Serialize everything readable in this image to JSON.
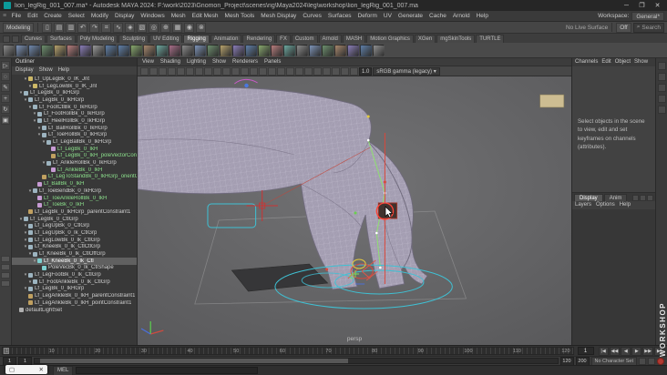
{
  "titlebar": {
    "title": "lion_legRig_001_007.ma* - Autodesk MAYA 2024: F:\\work\\2023\\Gnomon_Project\\scenes\\rig\\Maya2024\\leg\\workshop\\lion_legRig_001_007.ma",
    "minimize": "─",
    "maximize": "❐",
    "close": "✕"
  },
  "menubar": {
    "menus": [
      "File",
      "Edit",
      "Create",
      "Select",
      "Modify",
      "Display",
      "Windows",
      "Mesh",
      "Edit Mesh",
      "Mesh Tools",
      "Mesh Display",
      "Curves",
      "Surfaces",
      "Deform",
      "UV",
      "Generate",
      "Cache",
      "Arnold",
      "Help"
    ],
    "workspace_label": "Workspace:",
    "workspace_value": "General*"
  },
  "statusline": {
    "menu_set": "Modeling",
    "live_surface": "No Live Surface",
    "symmetry": "Off",
    "search": "Search",
    "icons": [
      {
        "name": "new-scene-icon",
        "glyph": "▯"
      },
      {
        "name": "open-scene-icon",
        "glyph": "▤"
      },
      {
        "name": "save-scene-icon",
        "glyph": "▥"
      },
      {
        "name": "undo-icon",
        "glyph": "↶"
      },
      {
        "name": "redo-icon",
        "glyph": "↷"
      },
      {
        "name": "snap-to-grid-icon",
        "glyph": "⌗"
      },
      {
        "name": "snap-to-curve-icon",
        "glyph": "∿"
      },
      {
        "name": "snap-to-point-icon",
        "glyph": "◈"
      },
      {
        "name": "snap-to-plane-icon",
        "glyph": "▧"
      },
      {
        "name": "make-live-icon",
        "glyph": "◎"
      },
      {
        "name": "construction-history-icon",
        "glyph": "⊕"
      },
      {
        "name": "render-view-icon",
        "glyph": "▦"
      },
      {
        "name": "render-current-frame-icon",
        "glyph": "◉"
      },
      {
        "name": "ipr-render-icon",
        "glyph": "⊗"
      }
    ]
  },
  "shelf": {
    "active_tab": "Rigging",
    "tabs": [
      "Curves",
      "Surfaces",
      "Poly Modeling",
      "Sculpting",
      "UV Editing",
      "Rigging",
      "Animation",
      "Rendering",
      "FX",
      "Custom",
      "Arnold",
      "MASH",
      "Motion Graphics",
      "XGen",
      "mgSkinTools",
      "TURTLE"
    ],
    "icon_colors": [
      "#8a8a8a",
      "#7d94b8",
      "#6f88ad",
      "#6d8f6d",
      "#b8a36d",
      "#b87d7d",
      "#8a7db8",
      "#9a9a9a",
      "#5f7fa8",
      "#5f7fa8",
      "#88a86d",
      "#a8886d",
      "#6da8a0",
      "#a86d88",
      "#8a8a8a",
      "#7d94b8",
      "#6d8f6d",
      "#b8a36d",
      "#8a7db8",
      "#5f7fa8",
      "#88a86d",
      "#b87d7d",
      "#6da8a0",
      "#8a8a8a",
      "#7d94b8",
      "#6d8f6d",
      "#a8886d",
      "#8a7db8",
      "#5f7fa8",
      "#8f8f8f"
    ]
  },
  "toolbox": {
    "tools": [
      [
        "select-tool-icon",
        "▷"
      ],
      [
        "lasso-tool-icon",
        "◌"
      ],
      [
        "paint-select-tool-icon",
        "✎"
      ],
      [
        "move-tool-icon",
        "+"
      ],
      [
        "rotate-tool-icon",
        "↻"
      ],
      [
        "scale-tool-icon",
        "▣"
      ]
    ],
    "layouts": [
      "layout-single-icon",
      "layout-four-view-icon",
      "layout-persp-outliner-icon",
      "layout-split-icon"
    ]
  },
  "outliner": {
    "title": "Outliner",
    "menus": [
      "Display",
      "Show",
      "Help"
    ],
    "items": [
      [
        2,
        "Lf_UpLegBk_0_IK_Jnt",
        "joint",
        "",
        "v"
      ],
      [
        3,
        "Lf_LegLowBk_0_IK_Jnt",
        "joint",
        "",
        "v"
      ],
      [
        1,
        "Lf_LegBk_0_IkHGrp",
        "group",
        "",
        "v"
      ],
      [
        2,
        "Lf_LegBk_0_IkHGrp",
        "group",
        "",
        "v"
      ],
      [
        3,
        "Lf_FootCtlBk_0_IkHGrp",
        "group",
        "",
        "v"
      ],
      [
        4,
        "Lf_FootRollBk_0_IkHGrp",
        "group",
        "",
        "v"
      ],
      [
        4,
        "Lf_HeelRollBk_0_IkHGrp",
        "group",
        "",
        "v"
      ],
      [
        5,
        "Lf_BallRollBk_0_IkHGrp",
        "group",
        "",
        "v"
      ],
      [
        5,
        "Lf_ToeRollBk_0_IkHGrp",
        "group",
        "",
        "v"
      ],
      [
        6,
        "Lf_LegBallBk_0_IkHGrp",
        "group",
        "",
        "v"
      ],
      [
        7,
        "Lf_LegBk_0_IkH",
        "ik",
        "green",
        ""
      ],
      [
        7,
        "Lf_LegBk_0_IkH_poleVectorConstraint1",
        "constraint",
        "green",
        ""
      ],
      [
        6,
        "Lf_AnkleRollBk_0_IkHGrp",
        "group",
        "",
        "v"
      ],
      [
        7,
        "Lf_AnkleBk_0_IkH",
        "ik",
        "green",
        ""
      ],
      [
        5,
        "Lf_LegToStandBk_0_IkHGrp_orientCon",
        "constraint",
        "green",
        ""
      ],
      [
        4,
        "Lf_BallBk_0_IkH",
        "ik",
        "green",
        ""
      ],
      [
        3,
        "Lf_ToeBendBk_0_IkHGrp",
        "group",
        "",
        "v"
      ],
      [
        4,
        "Lf_ToeAnkleRollBk_0_IkH",
        "ik",
        "green",
        ""
      ],
      [
        4,
        "Lf_ToeBk_0_IkH",
        "ik",
        "green",
        ""
      ],
      [
        2,
        "Lf_LegBk_0_IkHGrp_parentConstraint1",
        "constraint",
        "",
        ""
      ],
      [
        1,
        "Lf_LegBk_0_CtlGrp",
        "group",
        "",
        "v"
      ],
      [
        2,
        "Lf_LegUpBk_0_CtlGrp",
        "group",
        "",
        "v"
      ],
      [
        2,
        "Lf_LegUpBk_0_Ik_CtlGrp",
        "group",
        "",
        "v"
      ],
      [
        2,
        "Lf_LegLowBk_0_Ik_CtlGrp",
        "group",
        "",
        "v"
      ],
      [
        2,
        "Lf_KneeBk_0_Ik_CtlCtlGrp",
        "group",
        "",
        "v"
      ],
      [
        3,
        "Lf_KneeBk_0_Ik_CtlOffGrp",
        "group",
        "",
        "v"
      ],
      [
        4,
        "Lf_KneeBk_0_Ik_Ctl",
        "ctl",
        "selected",
        "v"
      ],
      [
        5,
        "PoleVecBk_0_Ik_CtlShape",
        "ctl",
        "",
        ""
      ],
      [
        2,
        "Lf_LegFootBk_0_Ik_CtlGrp",
        "group",
        "",
        "v"
      ],
      [
        3,
        "Lf_FootAnkleBk_0_Ik_CtlGrp",
        "group",
        "",
        "v"
      ],
      [
        2,
        "Lf_LegBk_0_IkHGrp",
        "group",
        "",
        "v"
      ],
      [
        2,
        "Lf_LegAnkleBk_0_IkH_parentConstraint1",
        "constraint",
        "",
        ""
      ],
      [
        2,
        "Lf_LegAnkleBk_0_IkH_pointConstraint1",
        "constraint",
        "",
        ""
      ],
      [
        0,
        "defaultLightSet",
        "set",
        "",
        ""
      ]
    ]
  },
  "viewport": {
    "menus": [
      "View",
      "Shading",
      "Lighting",
      "Show",
      "Renderers",
      "Panels"
    ],
    "toolbar_icons": [
      "select-camera-icon",
      "lock-camera-icon",
      "camera-attributes-icon",
      "bookmarks-icon",
      "image-plane-icon",
      "2d-pan-zoom-icon",
      "overscan-icon",
      "grease-pencil-icon",
      "grid-toggle-icon",
      "film-gate-icon",
      "resolution-gate-icon",
      "gate-mask-icon",
      "field-chart-icon",
      "safe-action-icon",
      "safe-title-icon",
      "wireframe-mode-icon",
      "shaded-mode-icon",
      "textured-mode-icon",
      "lights-icon",
      "shadows-icon",
      "ao-icon",
      "aa-icon",
      "xray-icon",
      "isolate-select-icon"
    ],
    "exposure": "1.0",
    "view_transform": "sRGB gamma (legacy)",
    "camera_label": "persp"
  },
  "channelbox": {
    "menus": [
      "Channels",
      "Edit",
      "Object",
      "Show"
    ],
    "empty_message": "Select objects in the scene to view, edit and set keyframes on channels (attributes)."
  },
  "layer_editor": {
    "tabs": [
      "Display",
      "Anim"
    ],
    "active_tab": "Display",
    "menus": [
      "Layers",
      "Options",
      "Help"
    ]
  },
  "right_strip": {
    "icons": [
      "channel-box-toggle-icon",
      "attribute-editor-toggle-icon",
      "tool-settings-toggle-icon",
      "modeling-toolkit-toggle-icon",
      "character-controls-icon"
    ]
  },
  "timeline": {
    "tick_labels": [
      "1",
      "10",
      "20",
      "30",
      "40",
      "50",
      "60",
      "70",
      "80",
      "90",
      "100",
      "110",
      "120"
    ],
    "current_frame": "1",
    "transport": [
      [
        "go-to-start-button",
        "|◀"
      ],
      [
        "step-back-button",
        "◀◀"
      ],
      [
        "play-backwards-button",
        "◀"
      ],
      [
        "play-forwards-button",
        "▶"
      ],
      [
        "step-forward-button",
        "▶▶"
      ],
      [
        "go-to-end-button",
        "▶|"
      ]
    ]
  },
  "range": {
    "start": "1",
    "min": "1",
    "max": "120",
    "end": "200",
    "character_set": "No Character Set"
  },
  "command": {
    "mode_label": "MEL",
    "input_value": "",
    "overlay_buttons": [
      "▢",
      "✕"
    ]
  },
  "watermark": {
    "text": "WORKSHOP"
  }
}
